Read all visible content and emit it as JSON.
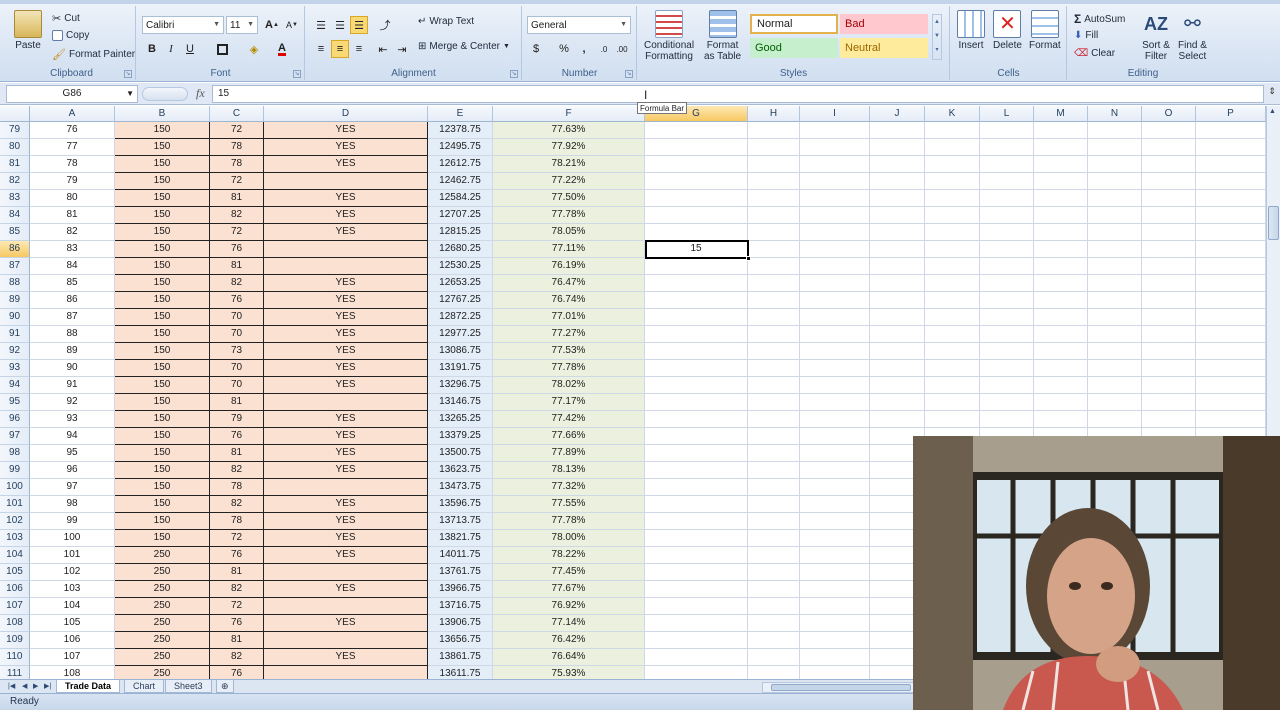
{
  "ribbon": {
    "clipboard": {
      "label": "Clipboard",
      "paste": "Paste",
      "cut": "Cut",
      "copy": "Copy",
      "format_painter": "Format Painter"
    },
    "font": {
      "label": "Font",
      "font_name": "Calibri",
      "font_size": "11",
      "bold": "B",
      "italic": "I",
      "underline": "U",
      "grow": "A",
      "shrink": "A"
    },
    "alignment": {
      "label": "Alignment",
      "wrap_text": "Wrap Text",
      "merge_center": "Merge & Center"
    },
    "number": {
      "label": "Number",
      "format": "General",
      "percent": "%",
      "comma": ","
    },
    "styles": {
      "label": "Styles",
      "conditional": "Conditional",
      "formatting": "Formatting",
      "format_as": "Format",
      "as_table": "as Table",
      "normal": "Normal",
      "bad": "Bad",
      "good": "Good",
      "neutral": "Neutral"
    },
    "cells": {
      "label": "Cells",
      "insert": "Insert",
      "delete": "Delete",
      "format": "Format"
    },
    "editing": {
      "label": "Editing",
      "autosum": "AutoSum",
      "fill": "Fill",
      "clear": "Clear",
      "sort_filter_1": "Sort &",
      "sort_filter_2": "Filter",
      "find_select_1": "Find &",
      "find_select_2": "Select"
    }
  },
  "formula_bar": {
    "name_box": "G86",
    "fx": "fx",
    "value": "15",
    "tooltip": "Formula Bar"
  },
  "columns": [
    "A",
    "B",
    "C",
    "D",
    "E",
    "F",
    "G",
    "H",
    "I",
    "J",
    "K",
    "L",
    "M",
    "N",
    "O",
    "P"
  ],
  "active_cell": {
    "col": "G",
    "row": "86",
    "value": "15"
  },
  "rows": [
    {
      "r": "79",
      "a": "76",
      "b": "150",
      "c": "72",
      "d": "YES",
      "e": "12378.75",
      "f": "77.63%"
    },
    {
      "r": "80",
      "a": "77",
      "b": "150",
      "c": "78",
      "d": "YES",
      "e": "12495.75",
      "f": "77.92%"
    },
    {
      "r": "81",
      "a": "78",
      "b": "150",
      "c": "78",
      "d": "YES",
      "e": "12612.75",
      "f": "78.21%"
    },
    {
      "r": "82",
      "a": "79",
      "b": "150",
      "c": "72",
      "d": "",
      "e": "12462.75",
      "f": "77.22%"
    },
    {
      "r": "83",
      "a": "80",
      "b": "150",
      "c": "81",
      "d": "YES",
      "e": "12584.25",
      "f": "77.50%"
    },
    {
      "r": "84",
      "a": "81",
      "b": "150",
      "c": "82",
      "d": "YES",
      "e": "12707.25",
      "f": "77.78%"
    },
    {
      "r": "85",
      "a": "82",
      "b": "150",
      "c": "72",
      "d": "YES",
      "e": "12815.25",
      "f": "78.05%"
    },
    {
      "r": "86",
      "a": "83",
      "b": "150",
      "c": "76",
      "d": "",
      "e": "12680.25",
      "f": "77.11%"
    },
    {
      "r": "87",
      "a": "84",
      "b": "150",
      "c": "81",
      "d": "",
      "e": "12530.25",
      "f": "76.19%"
    },
    {
      "r": "88",
      "a": "85",
      "b": "150",
      "c": "82",
      "d": "YES",
      "e": "12653.25",
      "f": "76.47%"
    },
    {
      "r": "89",
      "a": "86",
      "b": "150",
      "c": "76",
      "d": "YES",
      "e": "12767.25",
      "f": "76.74%"
    },
    {
      "r": "90",
      "a": "87",
      "b": "150",
      "c": "70",
      "d": "YES",
      "e": "12872.25",
      "f": "77.01%"
    },
    {
      "r": "91",
      "a": "88",
      "b": "150",
      "c": "70",
      "d": "YES",
      "e": "12977.25",
      "f": "77.27%"
    },
    {
      "r": "92",
      "a": "89",
      "b": "150",
      "c": "73",
      "d": "YES",
      "e": "13086.75",
      "f": "77.53%"
    },
    {
      "r": "93",
      "a": "90",
      "b": "150",
      "c": "70",
      "d": "YES",
      "e": "13191.75",
      "f": "77.78%"
    },
    {
      "r": "94",
      "a": "91",
      "b": "150",
      "c": "70",
      "d": "YES",
      "e": "13296.75",
      "f": "78.02%"
    },
    {
      "r": "95",
      "a": "92",
      "b": "150",
      "c": "81",
      "d": "",
      "e": "13146.75",
      "f": "77.17%"
    },
    {
      "r": "96",
      "a": "93",
      "b": "150",
      "c": "79",
      "d": "YES",
      "e": "13265.25",
      "f": "77.42%"
    },
    {
      "r": "97",
      "a": "94",
      "b": "150",
      "c": "76",
      "d": "YES",
      "e": "13379.25",
      "f": "77.66%"
    },
    {
      "r": "98",
      "a": "95",
      "b": "150",
      "c": "81",
      "d": "YES",
      "e": "13500.75",
      "f": "77.89%"
    },
    {
      "r": "99",
      "a": "96",
      "b": "150",
      "c": "82",
      "d": "YES",
      "e": "13623.75",
      "f": "78.13%"
    },
    {
      "r": "100",
      "a": "97",
      "b": "150",
      "c": "78",
      "d": "",
      "e": "13473.75",
      "f": "77.32%"
    },
    {
      "r": "101",
      "a": "98",
      "b": "150",
      "c": "82",
      "d": "YES",
      "e": "13596.75",
      "f": "77.55%"
    },
    {
      "r": "102",
      "a": "99",
      "b": "150",
      "c": "78",
      "d": "YES",
      "e": "13713.75",
      "f": "77.78%"
    },
    {
      "r": "103",
      "a": "100",
      "b": "150",
      "c": "72",
      "d": "YES",
      "e": "13821.75",
      "f": "78.00%"
    },
    {
      "r": "104",
      "a": "101",
      "b": "250",
      "c": "76",
      "d": "YES",
      "e": "14011.75",
      "f": "78.22%"
    },
    {
      "r": "105",
      "a": "102",
      "b": "250",
      "c": "81",
      "d": "",
      "e": "13761.75",
      "f": "77.45%"
    },
    {
      "r": "106",
      "a": "103",
      "b": "250",
      "c": "82",
      "d": "YES",
      "e": "13966.75",
      "f": "77.67%"
    },
    {
      "r": "107",
      "a": "104",
      "b": "250",
      "c": "72",
      "d": "",
      "e": "13716.75",
      "f": "76.92%"
    },
    {
      "r": "108",
      "a": "105",
      "b": "250",
      "c": "76",
      "d": "YES",
      "e": "13906.75",
      "f": "77.14%"
    },
    {
      "r": "109",
      "a": "106",
      "b": "250",
      "c": "81",
      "d": "",
      "e": "13656.75",
      "f": "76.42%"
    },
    {
      "r": "110",
      "a": "107",
      "b": "250",
      "c": "82",
      "d": "YES",
      "e": "13861.75",
      "f": "76.64%"
    },
    {
      "r": "111",
      "a": "108",
      "b": "250",
      "c": "76",
      "d": "",
      "e": "13611.75",
      "f": "75.93%"
    }
  ],
  "sheets": [
    "Trade Data",
    "Chart",
    "Sheet3"
  ],
  "active_sheet": "Trade Data",
  "status": "Ready",
  "colors": {
    "pink_fill": "#fbe1d2",
    "blue_fill": "#e4eef8",
    "green_fill": "#ebf1de",
    "ribbon": "#dbe6f4"
  }
}
